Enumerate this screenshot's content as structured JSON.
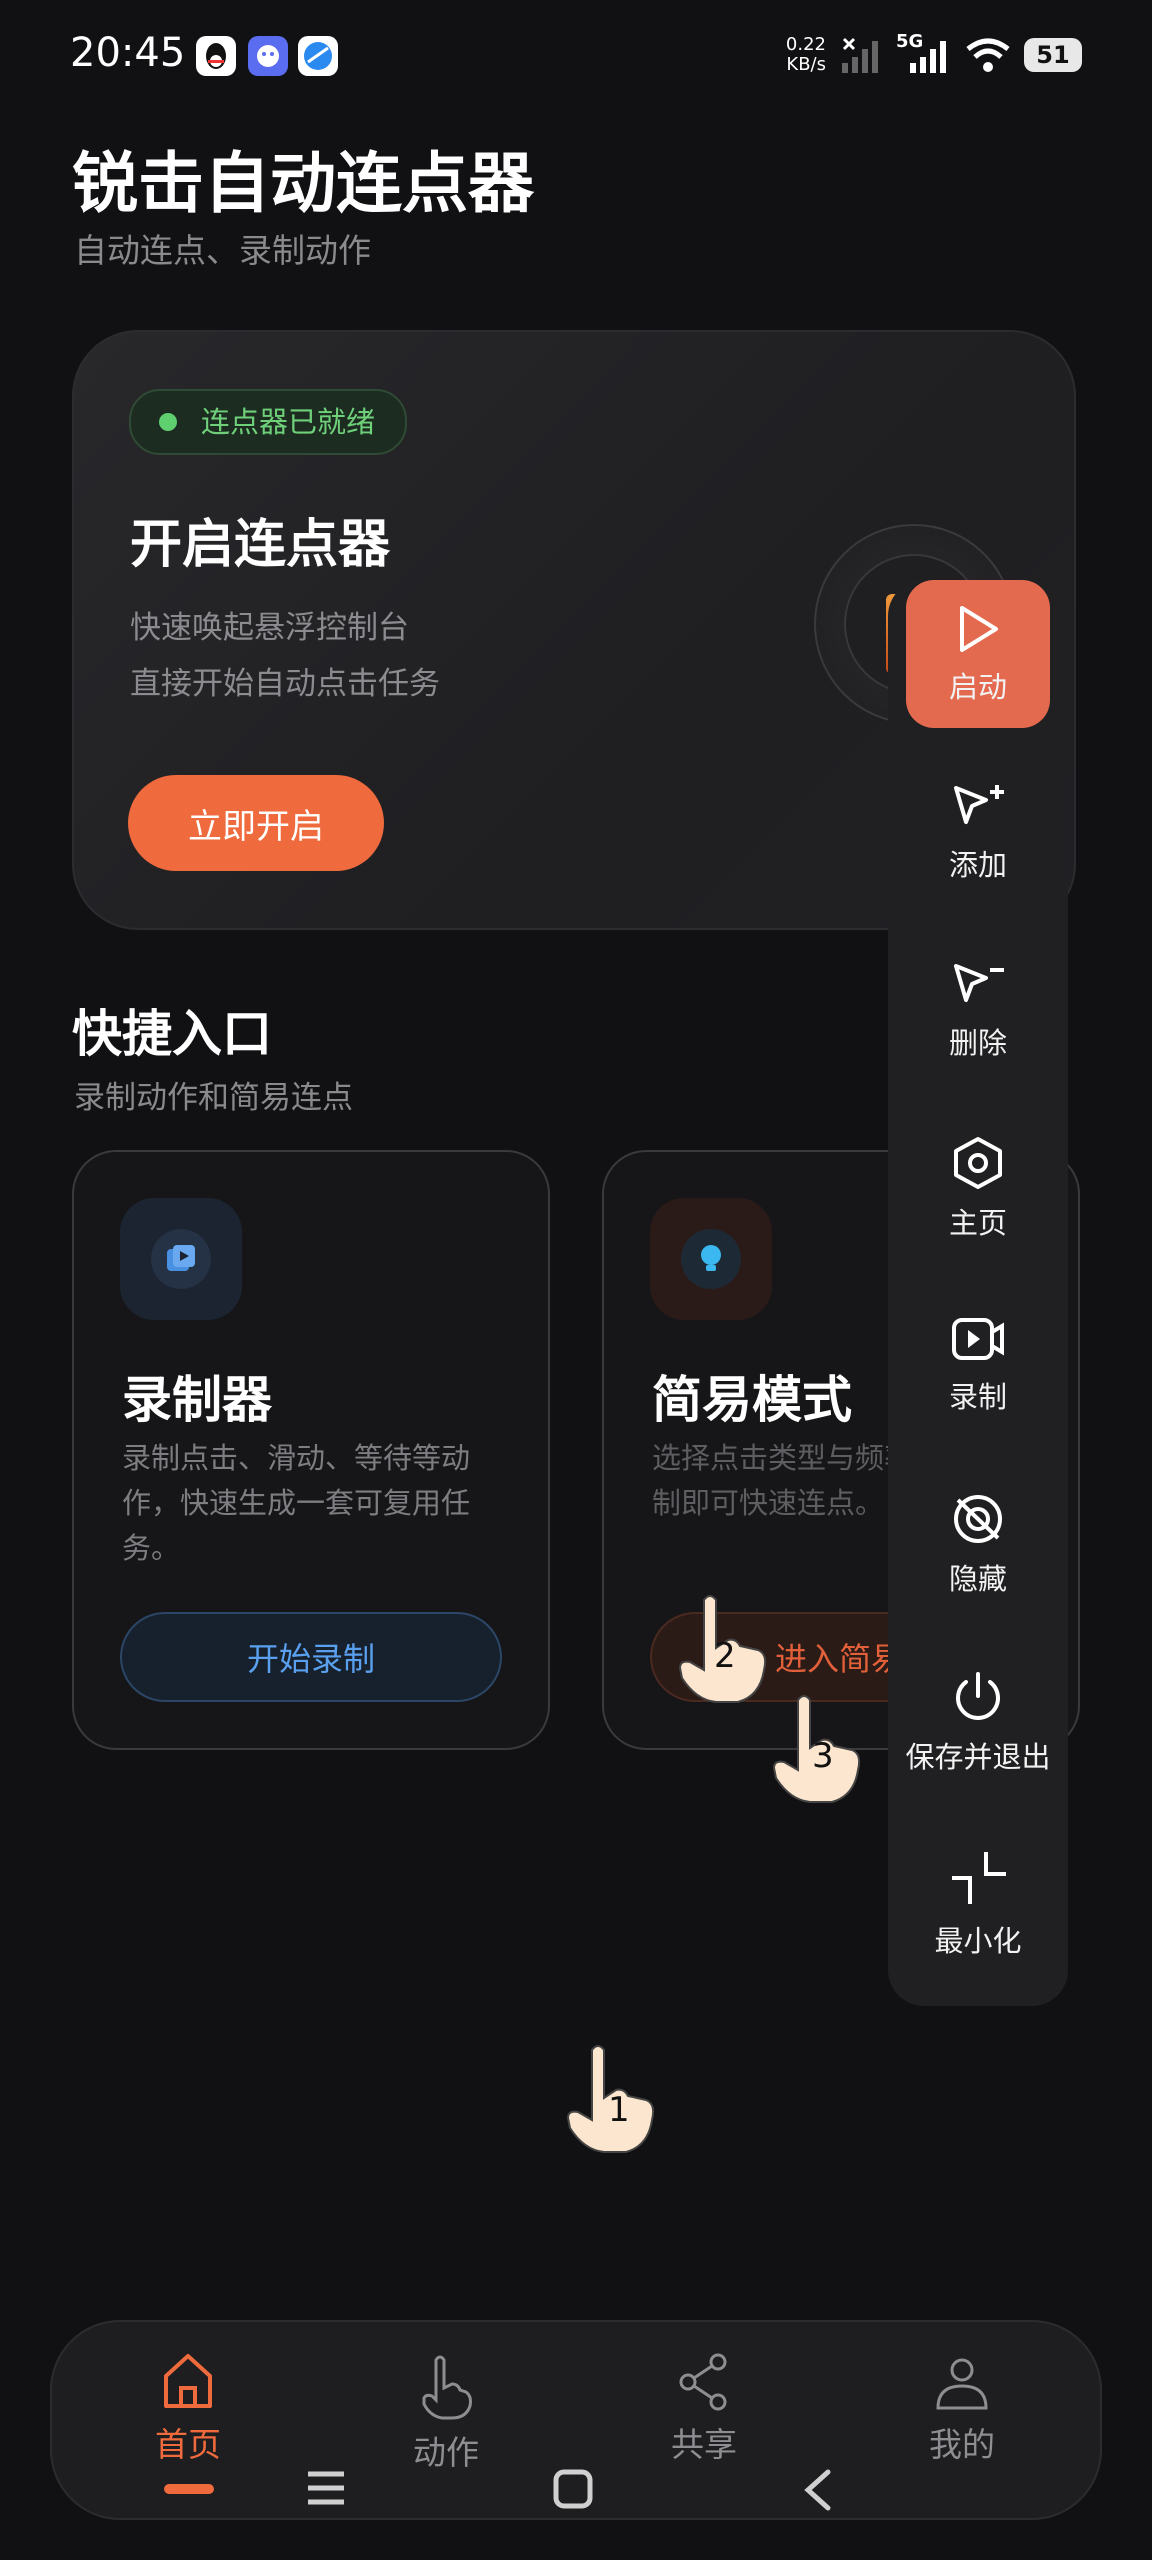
{
  "status_bar": {
    "time": "20:45",
    "net_speed_value": "0.22",
    "net_speed_unit": "KB/s",
    "network_type": "5G",
    "battery": "51",
    "app_icons": [
      "qq-icon",
      "chat-app-icon",
      "browser-app-icon"
    ]
  },
  "header": {
    "title": "锐击自动连点器",
    "subtitle": "自动连点、录制动作"
  },
  "hero": {
    "badge": "连点器已就绪",
    "title": "开启连点器",
    "desc_line1": "快速唤起悬浮控制台",
    "desc_line2": "直接开始自动点击任务",
    "button": "立即开启"
  },
  "quick": {
    "title": "快捷入口",
    "subtitle": "录制动作和简易连点",
    "cards": [
      {
        "title": "录制器",
        "desc": "录制点击、滑动、等待等动作，快速生成一套可复用任务。",
        "button": "开始录制"
      },
      {
        "title": "简易模式",
        "desc": "选择点击类型与频率，无需录制即可快速连点。",
        "button": "进入简易模式"
      }
    ]
  },
  "float_panel": {
    "items": [
      {
        "label": "启动",
        "icon": "play-icon"
      },
      {
        "label": "添加",
        "icon": "cursor-add-icon"
      },
      {
        "label": "删除",
        "icon": "cursor-remove-icon"
      },
      {
        "label": "主页",
        "icon": "hexagon-home-icon"
      },
      {
        "label": "录制",
        "icon": "video-record-icon"
      },
      {
        "label": "隐藏",
        "icon": "hide-icon"
      },
      {
        "label": "保存并退出",
        "icon": "power-icon"
      },
      {
        "label": "最小化",
        "icon": "minimize-icon"
      }
    ]
  },
  "touch_markers": [
    "1",
    "2",
    "3"
  ],
  "bottom_nav": {
    "items": [
      {
        "label": "首页",
        "icon": "home-icon",
        "active": true
      },
      {
        "label": "动作",
        "icon": "hand-icon",
        "active": false
      },
      {
        "label": "共享",
        "icon": "share-icon",
        "active": false
      },
      {
        "label": "我的",
        "icon": "profile-icon",
        "active": false
      }
    ]
  },
  "colors": {
    "background": "#111113",
    "accent": "#ef6a3c",
    "ready_green": "#5fd06f",
    "record_blue": "#4a90e2"
  }
}
